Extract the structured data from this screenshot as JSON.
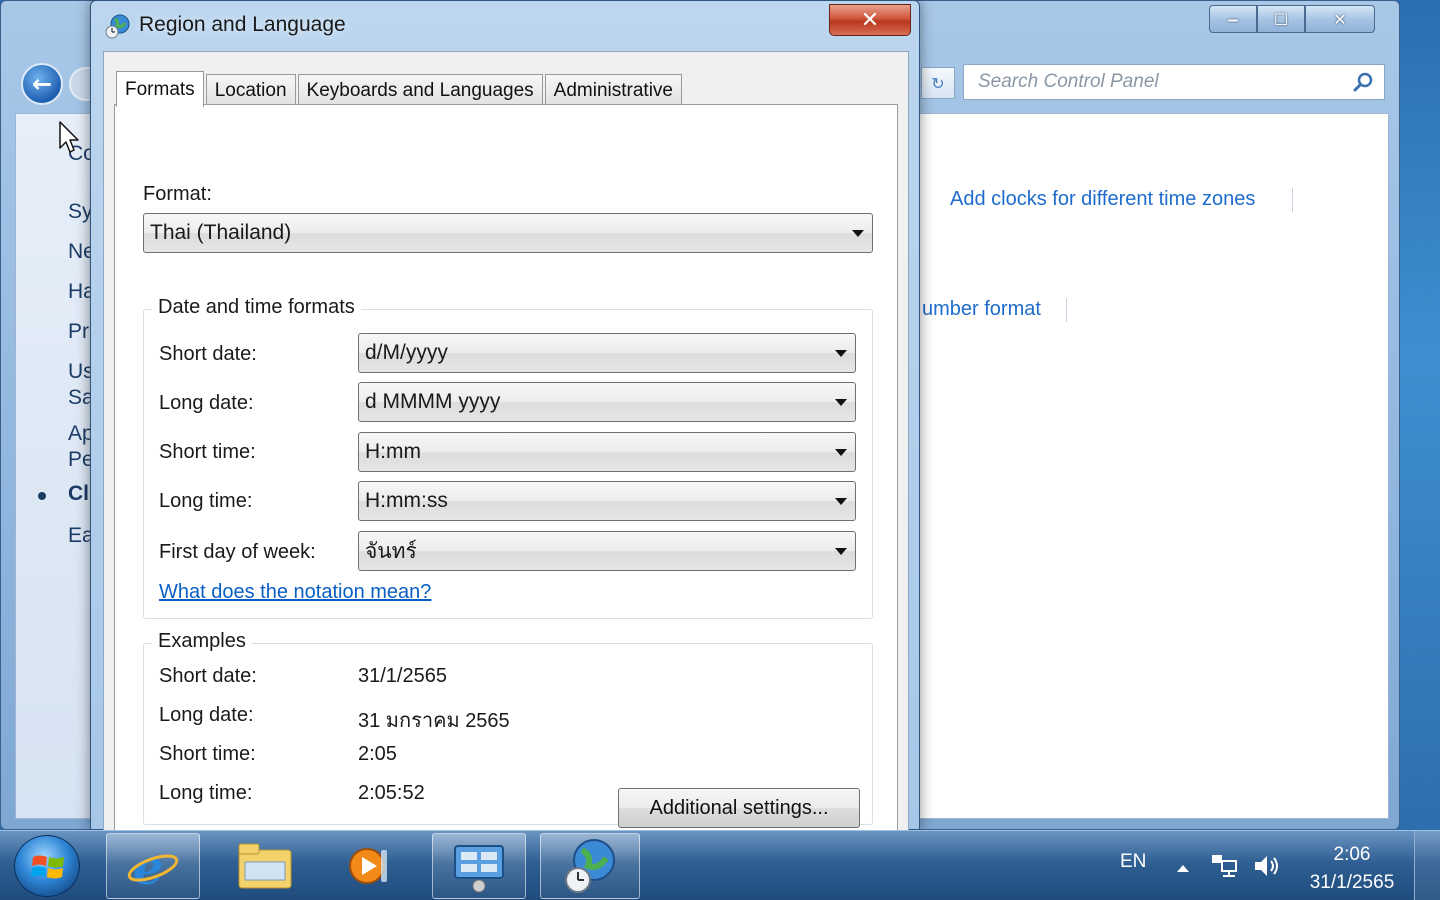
{
  "control_panel": {
    "search_placeholder": "Search Control Panel",
    "caption_buttons": {
      "minimize": "‒",
      "maximize": "☐",
      "close": "✕"
    },
    "left_nav_fragments": [
      "Co",
      "Sy",
      "Ne",
      "Ha",
      "Pr",
      "Us",
      "Sa",
      "Ap",
      "Pe",
      "Cl",
      "Ea"
    ],
    "links": {
      "add_clocks": "Add clocks for different time zones",
      "number_format_fragment": "umber format"
    }
  },
  "dialog": {
    "title": "Region and Language",
    "close_glyph": "✕",
    "tabs": [
      {
        "label": "Formats",
        "active": true
      },
      {
        "label": "Location",
        "active": false
      },
      {
        "label": "Keyboards and Languages",
        "active": false
      },
      {
        "label": "Administrative",
        "active": false
      }
    ],
    "format_label": "Format:",
    "format_value": "Thai (Thailand)",
    "date_time_group": {
      "title": "Date and time formats",
      "fields": [
        {
          "label": "Short date:",
          "value": "d/M/yyyy"
        },
        {
          "label": "Long date:",
          "value": "d MMMM yyyy"
        },
        {
          "label": "Short time:",
          "value": "H:mm"
        },
        {
          "label": "Long time:",
          "value": "H:mm:ss"
        },
        {
          "label": "First day of week:",
          "value": "จันทร์"
        }
      ],
      "notation_link": "What does the notation mean?"
    },
    "examples_group": {
      "title": "Examples",
      "rows": [
        {
          "label": "Short date:",
          "value": "31/1/2565"
        },
        {
          "label": "Long date:",
          "value": "31 มกราคม 2565"
        },
        {
          "label": "Short time:",
          "value": "2:05"
        },
        {
          "label": "Long time:",
          "value": "2:05:52"
        }
      ]
    },
    "additional_settings_button": "Additional settings..."
  },
  "taskbar": {
    "pinned": [
      "internet-explorer",
      "windows-explorer",
      "media-player",
      "control-panel",
      "region-and-language"
    ],
    "tray": {
      "language": "EN",
      "time": "2:06",
      "date": "31/1/2565"
    }
  },
  "colors": {
    "link": "#1e6ccc",
    "close_button": "#c9452b",
    "taskbar": "#2f5f93"
  }
}
